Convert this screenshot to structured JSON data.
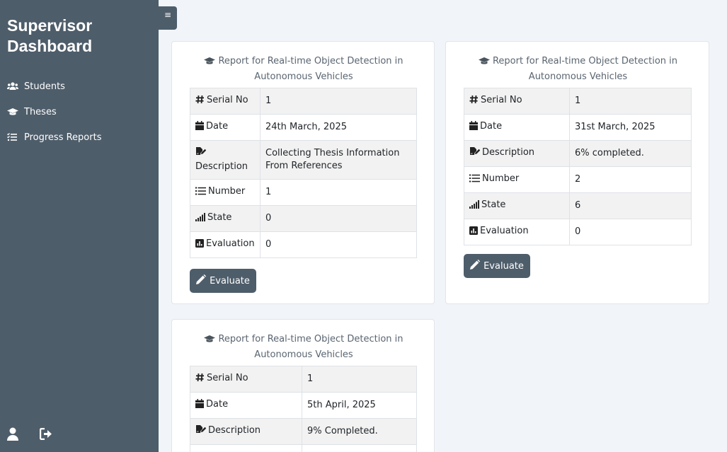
{
  "sidebar": {
    "brand_line1": "Supervisor",
    "brand_line2": "Dashboard",
    "items": [
      {
        "label": "Students",
        "icon": "users-icon"
      },
      {
        "label": "Theses",
        "icon": "graduation-cap-icon"
      },
      {
        "label": "Progress Reports",
        "icon": "list-check-icon"
      }
    ],
    "footer_icons": [
      "user-icon",
      "logout-icon"
    ]
  },
  "toggle": {
    "glyph": "≡"
  },
  "labels": {
    "serial": "Serial No",
    "date": "Date",
    "description": "Description",
    "number": "Number",
    "state": "State",
    "evaluation": "Evaluation",
    "evaluate_button": "Evaluate"
  },
  "reports": [
    {
      "title": "Report for Real-time Object Detection in Autonomous Vehicles",
      "serial": "1",
      "date": "24th March, 2025",
      "description": "Collecting Thesis Information From References",
      "number": "1",
      "state": "0",
      "evaluation": "0"
    },
    {
      "title": "Report for Real-time Object Detection in Autonomous Vehicles",
      "serial": "1",
      "date": "31st March, 2025",
      "description": "6% completed.",
      "number": "2",
      "state": "6",
      "evaluation": "0"
    },
    {
      "title": "Report for Real-time Object Detection in Autonomous Vehicles",
      "serial": "1",
      "date": "5th April, 2025",
      "description": "9% Completed."
    }
  ]
}
